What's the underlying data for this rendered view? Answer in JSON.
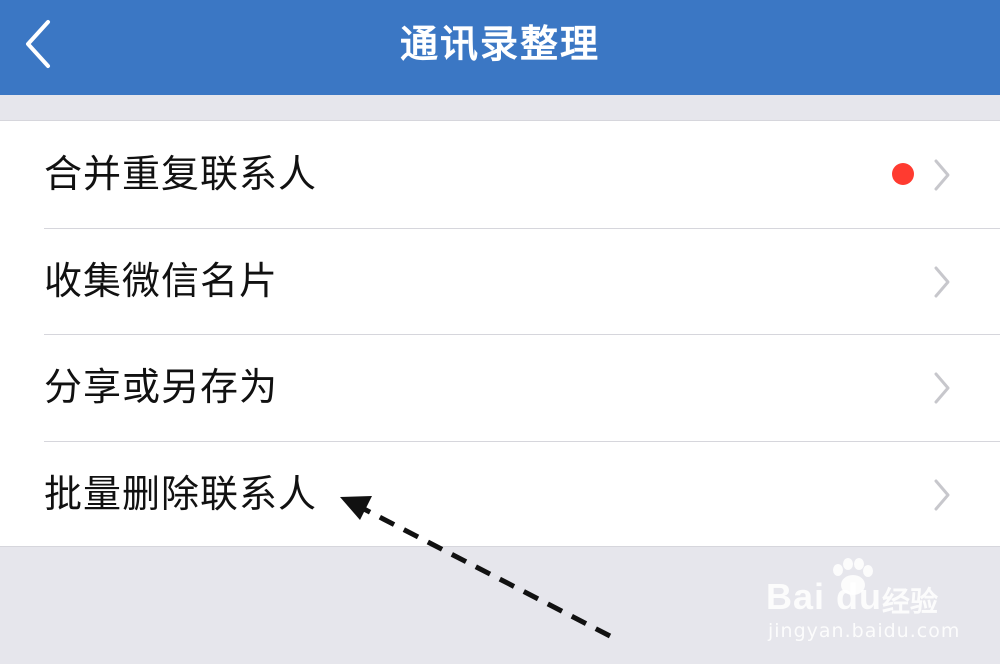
{
  "header": {
    "title": "通讯录整理",
    "back_icon": "chevron-left-icon"
  },
  "menu": {
    "items": [
      {
        "label": "合并重复联系人",
        "has_badge": true
      },
      {
        "label": "收集微信名片",
        "has_badge": false
      },
      {
        "label": "分享或另存为",
        "has_badge": false
      },
      {
        "label": "批量删除联系人",
        "has_badge": false
      }
    ]
  },
  "watermark": {
    "brand": "Bai du",
    "suffix": "经验",
    "url": "jingyan.baidu.com"
  },
  "colors": {
    "nav_bar": "#3b77c4",
    "badge": "#ff3b30",
    "background": "#e6e6ec"
  }
}
